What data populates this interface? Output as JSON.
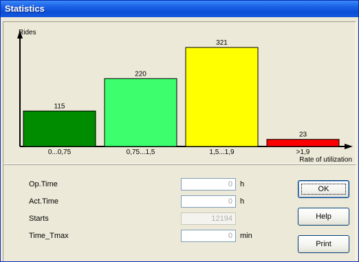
{
  "window": {
    "title": "Statistics"
  },
  "chart_data": {
    "type": "bar",
    "categories": [
      "0...0,75",
      "0,75...1,5",
      "1,5...1,9",
      ">1,9"
    ],
    "values": [
      115,
      220,
      321,
      23
    ],
    "colors": [
      "#008c00",
      "#3dff6e",
      "#ffff00",
      "#ff0000"
    ],
    "ylabel": "Rides",
    "xlabel": "Rate of utilization",
    "ylim": [
      0,
      321
    ],
    "grid": false,
    "legend": "none"
  },
  "form": {
    "op_time": {
      "label": "Op.Time",
      "value": "0",
      "unit": "h"
    },
    "act_time": {
      "label": "Act.Time",
      "value": "0",
      "unit": "h"
    },
    "starts": {
      "label": "Starts",
      "value": "12194"
    },
    "time_tmax": {
      "label": "Time_Tmax",
      "value": "0",
      "unit": "min"
    }
  },
  "buttons": {
    "ok": "OK",
    "help": "Help",
    "print": "Print"
  }
}
